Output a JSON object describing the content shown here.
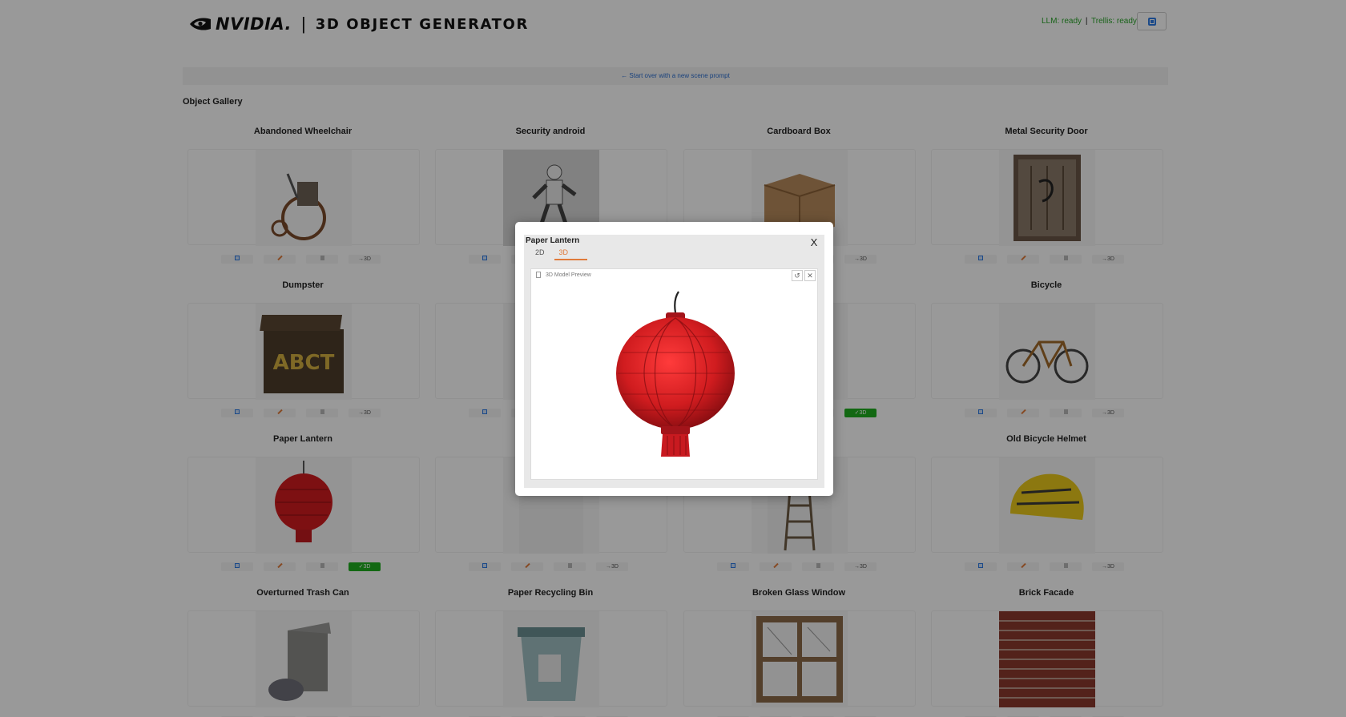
{
  "header": {
    "brand": "NVIDIA.",
    "separator": "|",
    "app_title": "3D OBJECT GENERATOR",
    "llm_status": "LLM: ready",
    "trellis_status": "Trellis: ready",
    "status_separator": "|"
  },
  "start_over_label": "← Start over with a new scene prompt",
  "gallery": {
    "title": "Object Gallery",
    "gen3d_label": "→3D",
    "gen3d_done_label": "✓3D",
    "items": [
      {
        "name": "Abandoned Wheelchair",
        "has3d": false
      },
      {
        "name": "Security android",
        "has3d": false
      },
      {
        "name": "Cardboard Box",
        "has3d": false
      },
      {
        "name": "Metal Security Door",
        "has3d": false
      },
      {
        "name": "Dumpster",
        "has3d": false
      },
      {
        "name": "",
        "has3d": false
      },
      {
        "name": "",
        "has3d": true
      },
      {
        "name": "Bicycle",
        "has3d": false
      },
      {
        "name": "Paper Lantern",
        "has3d": true
      },
      {
        "name": "",
        "has3d": false
      },
      {
        "name": "",
        "has3d": false
      },
      {
        "name": "Old Bicycle Helmet",
        "has3d": false
      },
      {
        "name": "Overturned Trash Can",
        "has3d": false
      },
      {
        "name": "Paper Recycling Bin",
        "has3d": false
      },
      {
        "name": "Broken Glass Window",
        "has3d": false
      },
      {
        "name": "Brick Facade",
        "has3d": false
      }
    ]
  },
  "modal": {
    "title": "Paper Lantern",
    "close_label": "X",
    "tabs": [
      "2D",
      "3D"
    ],
    "active_tab": "3D",
    "preview_label": "3D Model Preview"
  },
  "colors": {
    "accent": "#e07a3a",
    "status_green": "#2aa52a",
    "link_blue": "#2c6fd1",
    "done_green": "#1fae1f",
    "lantern_red": "#d01c1f"
  }
}
